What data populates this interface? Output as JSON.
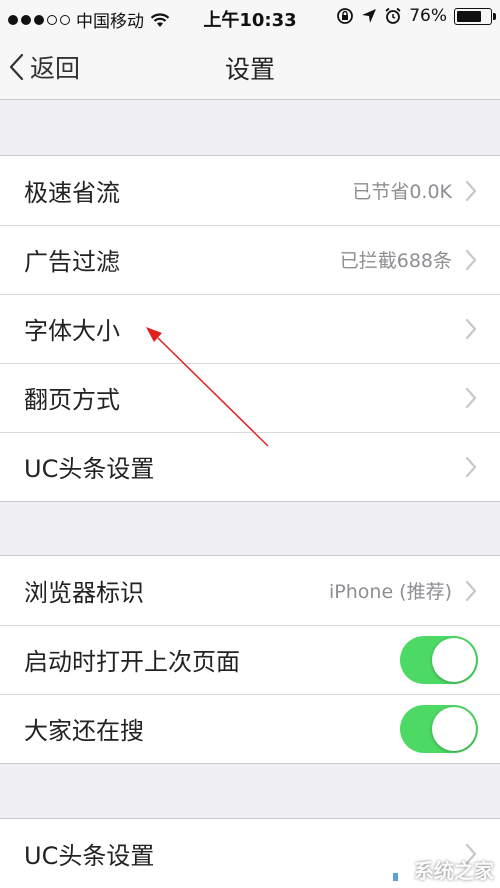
{
  "status_bar": {
    "carrier": "中国移动",
    "time": "上午10:33",
    "battery_percent": "76%",
    "battery_level": 0.76
  },
  "nav": {
    "back_label": "返回",
    "title": "设置"
  },
  "group1": {
    "items": [
      {
        "label": "极速省流",
        "value": "已节省0.0K"
      },
      {
        "label": "广告过滤",
        "value": "已拦截688条"
      },
      {
        "label": "字体大小"
      },
      {
        "label": "翻页方式"
      },
      {
        "label": "UC头条设置"
      }
    ]
  },
  "group2": {
    "items": [
      {
        "label": "浏览器标识",
        "value": "iPhone (推荐)"
      },
      {
        "label": "启动时打开上次页面",
        "toggle": true
      },
      {
        "label": "大家还在搜",
        "toggle": true
      }
    ]
  },
  "group3": {
    "items": [
      {
        "label": "UC头条设置"
      }
    ]
  },
  "colors": {
    "toggle_on": "#4cd964",
    "annotation_arrow": "#e02020"
  },
  "watermark": {
    "text": "系统之家"
  }
}
